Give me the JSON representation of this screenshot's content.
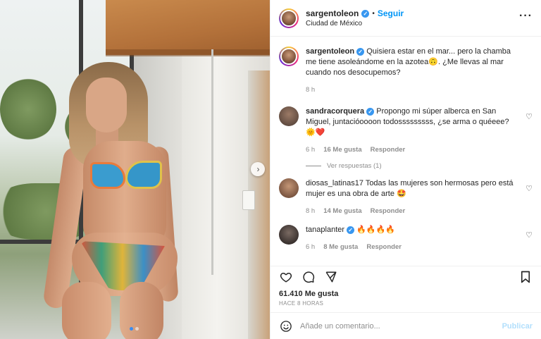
{
  "post": {
    "author": "sargentoleon",
    "follow_label": "Seguir",
    "separator": "•",
    "location": "Ciudad de México",
    "more_icon": "more-horizontal-icon",
    "verified_mark": "✓"
  },
  "media": {
    "next_icon": "chevron-right-icon",
    "next_glyph": "›",
    "slide_count": 2,
    "active_slide": 1
  },
  "caption": {
    "username": "sargentoleon",
    "text": "Quisiera estar en el mar... pero la chamba me tiene asoleándome en la azotea🙃. ¿Me llevas al mar cuando nos desocupemos?",
    "time": "8 h"
  },
  "comments": [
    {
      "username": "sandracorquera",
      "verified": true,
      "text": "Propongo mi súper alberca en San Miguel, juntacióoooon todosssssssss, ¿se arma o quéeee? 🌞❤️",
      "time": "6 h",
      "likes": "16 Me gusta",
      "reply": "Responder",
      "avatar_color": "#5a4a40"
    },
    {
      "username": "diosas_latinas17",
      "verified": false,
      "text": "Todas las mujeres son hermosas pero está mujer es una obra de arte 🤩",
      "time": "8 h",
      "likes": "14 Me gusta",
      "reply": "Responder",
      "avatar_color": "#8a6048"
    },
    {
      "username": "tanaplanter",
      "verified": true,
      "text": "🔥🔥🔥🔥",
      "time": "6 h",
      "likes": "8 Me gusta",
      "reply": "Responder",
      "avatar_color": "#2f2a2a"
    }
  ],
  "view_replies": "Ver respuestas (1)",
  "actions": {
    "like_icon": "heart-icon",
    "comment_icon": "comment-icon",
    "share_icon": "send-icon",
    "save_icon": "bookmark-icon",
    "comment_like_icon": "small-heart-icon"
  },
  "likes_count": "61.410 Me gusta",
  "posted_ago": "HACE 8 HORAS",
  "composer": {
    "emoji_icon": "emoji-smile-icon",
    "placeholder": "Añade un comentario...",
    "publish_label": "Publicar"
  },
  "colors": {
    "accent": "#0095f6",
    "verified": "#3897f0",
    "muted": "#8e8e8e",
    "publish_disabled": "#b2dffc"
  }
}
